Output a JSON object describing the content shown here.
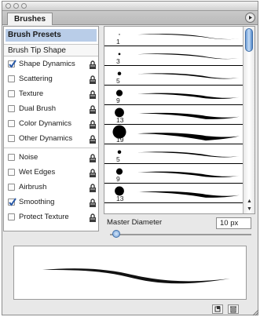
{
  "panel": {
    "tab_label": "Brushes"
  },
  "sidebar": {
    "presets_label": "Brush Presets",
    "tip_shape_label": "Brush Tip Shape",
    "options": [
      {
        "label": "Shape Dynamics",
        "checked": true
      },
      {
        "label": "Scattering",
        "checked": false
      },
      {
        "label": "Texture",
        "checked": false
      },
      {
        "label": "Dual Brush",
        "checked": false
      },
      {
        "label": "Color Dynamics",
        "checked": false
      },
      {
        "label": "Other Dynamics",
        "checked": false
      }
    ],
    "options2": [
      {
        "label": "Noise",
        "checked": false
      },
      {
        "label": "Wet Edges",
        "checked": false
      },
      {
        "label": "Airbrush",
        "checked": false
      },
      {
        "label": "Smoothing",
        "checked": true
      },
      {
        "label": "Protect Texture",
        "checked": false
      }
    ]
  },
  "brushes": [
    {
      "size": "1"
    },
    {
      "size": "3"
    },
    {
      "size": "5"
    },
    {
      "size": "9"
    },
    {
      "size": "13"
    },
    {
      "size": "19"
    },
    {
      "size": "5"
    },
    {
      "size": "9"
    },
    {
      "size": "13"
    }
  ],
  "master_diameter": {
    "label": "Master Diameter",
    "value": "10 px",
    "slider_fraction": 0.05
  },
  "colors": {
    "selection": "#b9cde8",
    "scroll_thumb": "#6f9fd8"
  },
  "icons": {
    "lock": "lock-icon",
    "menu": "panel-menu-arrow-icon",
    "new": "new-brush-icon",
    "trash": "trash-icon"
  }
}
